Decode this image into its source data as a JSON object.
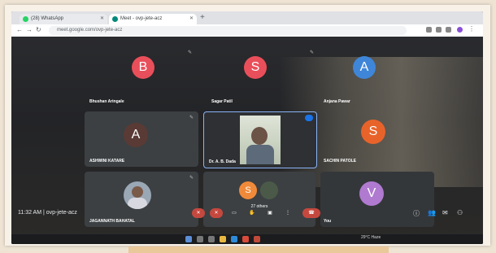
{
  "browser": {
    "tabs": [
      {
        "label": "(28) WhatsApp"
      },
      {
        "label": "Meet - ovp-jete-acz"
      }
    ],
    "url": "meet.google.com/ovp-jete-acz"
  },
  "participants": [
    {
      "name": "Bhushan Aringale",
      "initial": "B",
      "color": "#e94f5a"
    },
    {
      "name": "Sagar Patil",
      "initial": "S",
      "color": "#e94f5a"
    },
    {
      "name": "Anjana Pawar",
      "initial": "A",
      "color": "#3f86d8"
    },
    {
      "name": "ASHWINI KATARE",
      "initial": "A",
      "color": "#5a3a35"
    },
    {
      "name": "Dr. A. B. Dada",
      "initial": "",
      "color": "#cfd8c4"
    },
    {
      "name": "SACHIN PATOLE",
      "initial": "S",
      "color": "#e8632a"
    },
    {
      "name": "JAGANNATH BAHATAL",
      "initial": "",
      "color": "#9aa7b5"
    },
    {
      "name": "27 others",
      "initial": "S",
      "color": "#f08a3a"
    },
    {
      "name": "You",
      "initial": "V",
      "color": "#b07ad0"
    }
  ],
  "meeting": {
    "time": "11:32 AM",
    "code": "ovp-jete-acz"
  },
  "taskbar": {
    "weather": "29°C Haze"
  }
}
